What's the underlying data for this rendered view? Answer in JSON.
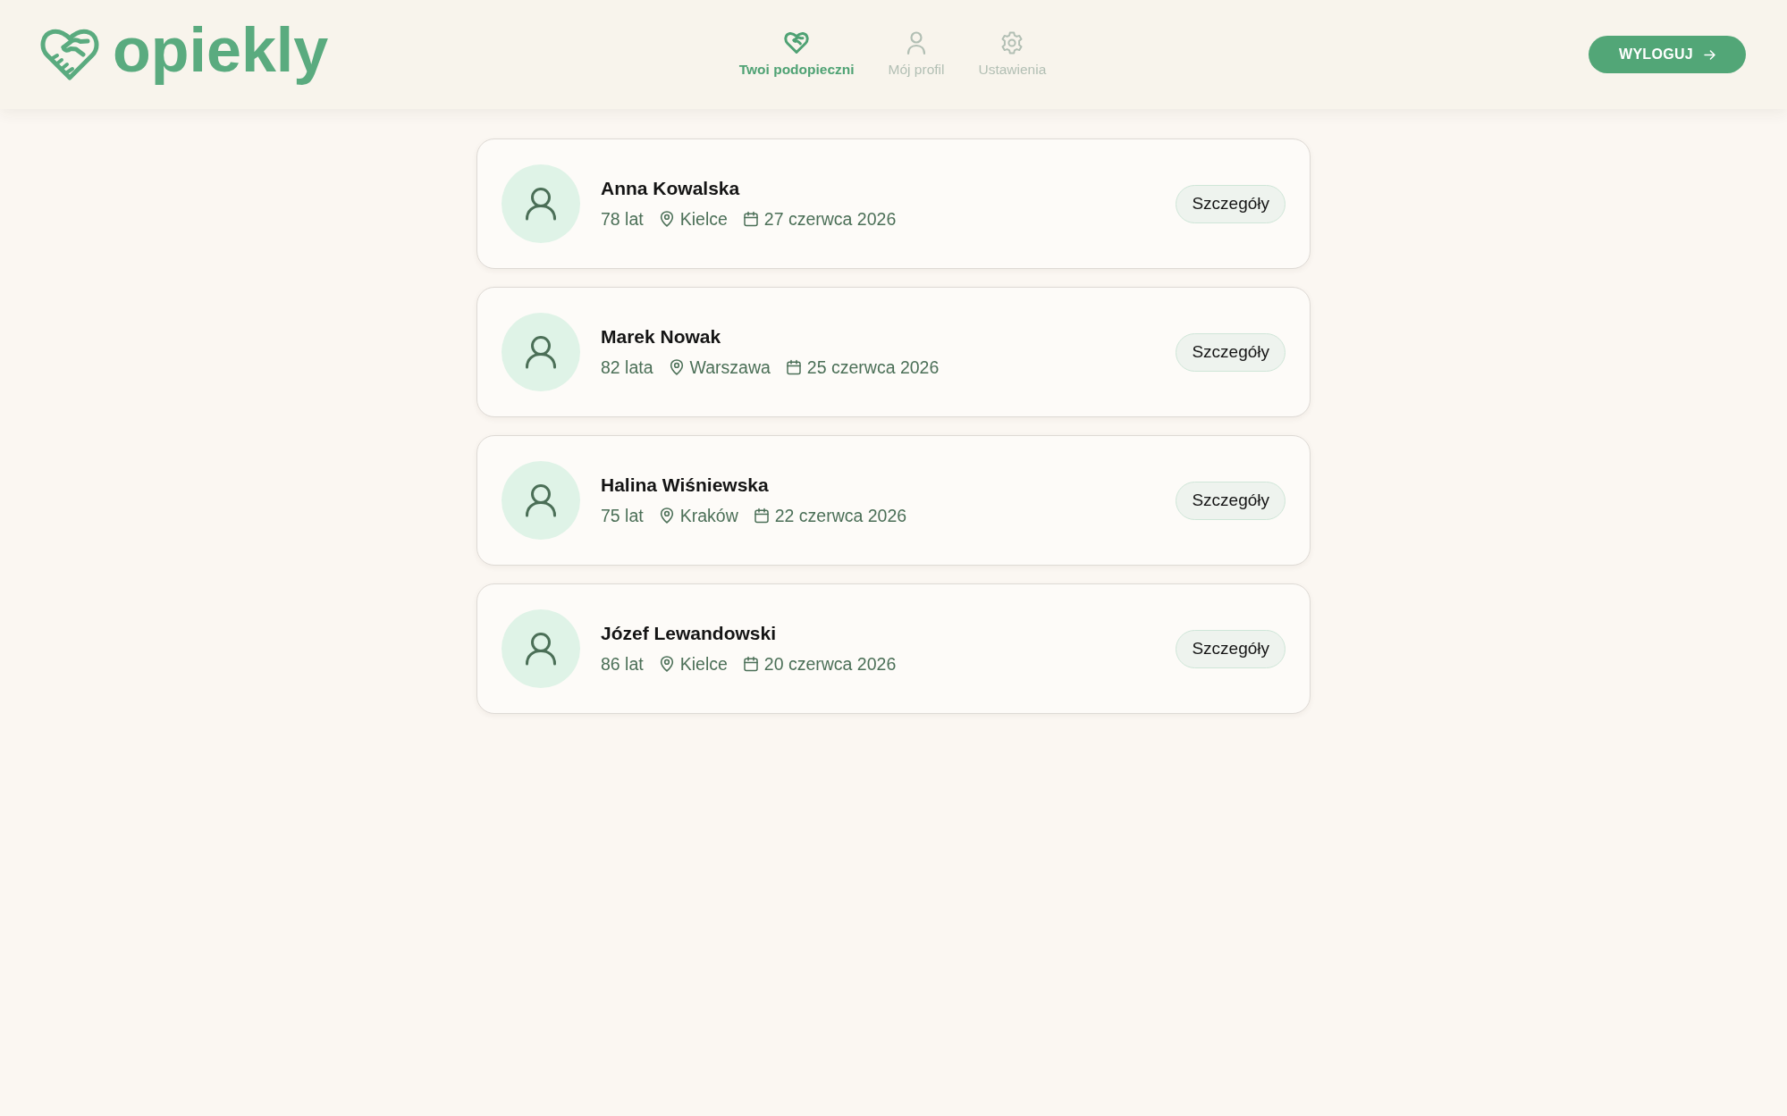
{
  "header": {
    "logo": "opiekly",
    "nav": [
      {
        "label": "Twoi podopieczni",
        "kind": "heart",
        "selected": true
      },
      {
        "label": "Mój profil",
        "kind": "person",
        "selected": false
      },
      {
        "label": "Ustawienia",
        "kind": "gear",
        "selected": false
      }
    ],
    "logout": "WYLOGUJ"
  },
  "patients": [
    {
      "name": "Anna Kowalska",
      "age": "78 lat",
      "city": "Kielce",
      "date": "27 czerwca 2026",
      "button": "Szczegóły"
    },
    {
      "name": "Marek Nowak",
      "age": "82 lata",
      "city": "Warszawa",
      "date": "25 czerwca 2026",
      "button": "Szczegóły"
    },
    {
      "name": "Halina Wiśniewska",
      "age": "75 lat",
      "city": "Kraków",
      "date": "22 czerwca 2026",
      "button": "Szczegóły"
    },
    {
      "name": "Józef Lewandowski",
      "age": "86 lat",
      "city": "Kielce",
      "date": "20 czerwca 2026",
      "button": "Szczegóły"
    }
  ]
}
